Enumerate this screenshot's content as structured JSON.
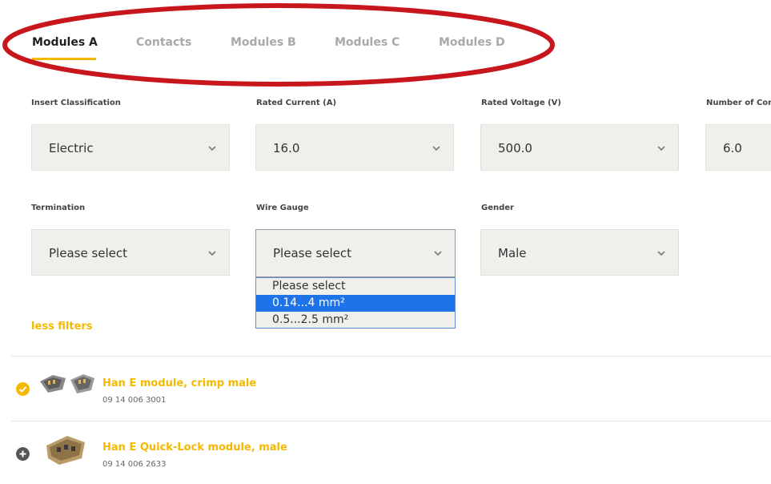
{
  "tabs": [
    {
      "label": "Modules A",
      "active": true
    },
    {
      "label": "Contacts",
      "active": false
    },
    {
      "label": "Modules B",
      "active": false
    },
    {
      "label": "Modules C",
      "active": false
    },
    {
      "label": "Modules D",
      "active": false
    }
  ],
  "filters": {
    "insert_classification": {
      "label": "Insert Classification",
      "value": "Electric"
    },
    "rated_current": {
      "label": "Rated Current (A)",
      "value": "16.0"
    },
    "rated_voltage": {
      "label": "Rated Voltage (V)",
      "value": "500.0"
    },
    "number_of_contacts": {
      "label": "Number of Cont",
      "value": "6.0"
    },
    "termination": {
      "label": "Termination",
      "value": "Please select"
    },
    "wire_gauge": {
      "label": "Wire Gauge",
      "value": "Please select",
      "options": [
        "Please select",
        "0.14...4 mm²",
        "0.5...2.5 mm²"
      ],
      "highlighted_index": 1
    },
    "gender": {
      "label": "Gender",
      "value": "Male"
    }
  },
  "less_filters": "less filters",
  "products": [
    {
      "title": "Han E module, crimp male",
      "number": "09 14 006 3001",
      "selected": true
    },
    {
      "title": "Han E Quick-Lock module, male",
      "number": "09 14 006 2633",
      "selected": false
    }
  ],
  "colors": {
    "accent": "#f5b800",
    "annotation": "#c8161d",
    "select_bg": "#f1efeb",
    "option_highlight": "#1e73e8"
  },
  "icons": [
    "chevron-down-icon",
    "check-circle-icon",
    "plus-circle-icon"
  ]
}
